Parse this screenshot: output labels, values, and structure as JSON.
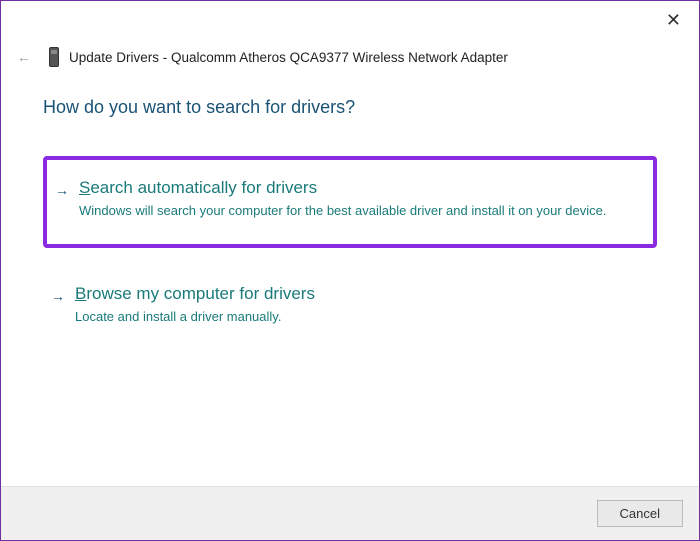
{
  "window": {
    "title": "Update Drivers - Qualcomm Atheros QCA9377 Wireless Network Adapter"
  },
  "main": {
    "heading": "How do you want to search for drivers?",
    "options": [
      {
        "accel": "S",
        "title_rest": "earch automatically for drivers",
        "description": "Windows will search your computer for the best available driver and install it on your device.",
        "highlighted": true
      },
      {
        "accel": "B",
        "title_rest": "rowse my computer for drivers",
        "description": "Locate and install a driver manually.",
        "highlighted": false
      }
    ]
  },
  "footer": {
    "cancel_label": "Cancel"
  }
}
